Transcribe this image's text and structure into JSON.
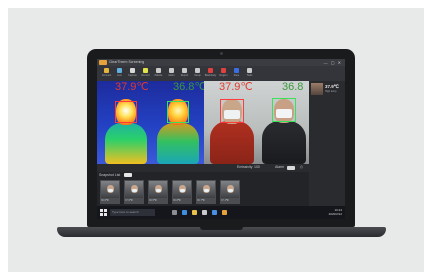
{
  "app": {
    "title": "ClearTherm Screening",
    "window_controls": "— ▢ ✕"
  },
  "toolbar": {
    "items": [
      {
        "label": "Connect",
        "color": "#e6b53a"
      },
      {
        "label": "Live",
        "color": "#5fb0e0"
      },
      {
        "label": "Capture",
        "color": "#d9d9d9"
      },
      {
        "label": "Record",
        "color": "#e2e24a"
      },
      {
        "label": "Palette",
        "color": "#c9c9c9"
      },
      {
        "label": "Alarm",
        "color": "#c9c9c9"
      },
      {
        "label": "Report",
        "color": "#c9c9c9"
      },
      {
        "label": "Setup",
        "color": "#c9c9c9"
      },
      {
        "label": "Blackbody",
        "color": "#e04040"
      },
      {
        "label": "Region",
        "color": "#e04040"
      },
      {
        "label": "Face",
        "color": "#3a6ee0"
      },
      {
        "label": "Tools",
        "color": "#c9c9c9"
      }
    ]
  },
  "viewer": {
    "thermal_labels": [
      {
        "text": "37.9℃",
        "color": "#e23b2e"
      },
      {
        "text": "36.8℃",
        "color": "#3b9a3b"
      }
    ],
    "visible_labels": [
      {
        "text": "37.9℃",
        "color": "#e23b2e"
      },
      {
        "text": "36.8",
        "color": "#3b9a3b"
      }
    ]
  },
  "statusbar": {
    "left_text": "Emissivity",
    "mid_text": "100",
    "right_text": "Alarm"
  },
  "capture": {
    "header": "Snapshot List",
    "thumbnails": [
      {
        "caption": "36.9℃"
      },
      {
        "caption": "37.9℃"
      },
      {
        "caption": "36.5℃"
      },
      {
        "caption": "36.8℃"
      },
      {
        "caption": "36.7℃"
      },
      {
        "caption": "37.1℃"
      }
    ]
  },
  "side_panel": {
    "temperature": "37.9℃",
    "sub": "High temp"
  },
  "taskbar": {
    "search_placeholder": "Type here to search",
    "time": "10:24",
    "date": "2020/2/12"
  }
}
